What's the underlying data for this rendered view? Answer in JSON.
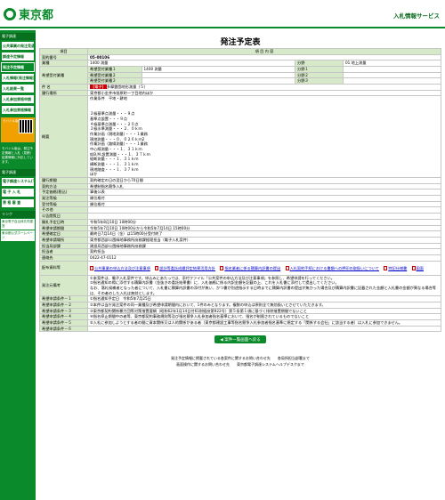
{
  "header": {
    "logo": "東京都",
    "service": "入札情報サービス"
  },
  "sidebar": {
    "sec1": "電子調達",
    "items": [
      "公共事業の発注見通し",
      "調達予定情報",
      "発注予定情報",
      "入札情報(発注情報)",
      "入札結果一覧",
      "入札参加資格申請",
      "入札参加資格情報"
    ],
    "mobile": "モバイル版はこちら",
    "mobile_note": "モバイル版は、発注予定情報と入札（見積）結果情報に対応しています。",
    "sec2": "電子調達",
    "sys_btn": "電子調達システム(TOP)",
    "nav": [
      "電 子 入 札",
      "資 格 審 査"
    ],
    "sec3": "リンク",
    "links": [
      "東京電子自治体共同運営",
      "東京都公式ホームページ"
    ]
  },
  "page": {
    "title": "発注予定表",
    "col_item": "項目",
    "col_content": "項 目 内 容"
  },
  "rows": {
    "contract_no": {
      "label": "契約番号",
      "value": "05-00106"
    },
    "gyoshu": {
      "label": "業種",
      "value": "1400 測量",
      "bunya_label": "分野",
      "bunya_value": "01 地上測量"
    },
    "kibou": [
      {
        "label": "希望受付業種１",
        "value": "1400 測量",
        "bunya_label": "分野１",
        "bunya_value": ""
      },
      {
        "label": "希望受付業種２",
        "value": "",
        "bunya_label": "分野２",
        "bunya_value": ""
      },
      {
        "label": "希望受付業種３",
        "value": "",
        "bunya_label": "分野３",
        "bunya_value": ""
      }
    ],
    "kibou_group_label": "希望受付業種",
    "kenmei": {
      "label": "件 名",
      "badge": "【電子】",
      "value": "多摩霊園地形測量（５）"
    },
    "place": {
      "label": "履行場所",
      "value": "東京都小金井市前原町一丁目地内ほか"
    },
    "gaiyo": {
      "label": "概要",
      "value": "作業条件　平地・耕地\n\n\n３級基準点測量・・・９点\n基準点設置・・・９点\n４級基準点測量・・・２０点\n３級水準測量・・・２．０ｋｍ\n作業計画（現地測量）・・・１業務\n現地測量・・・０．０２６ｋｍ2\n作業計画（路線測量）・・・１業務\n中心線測量・・・１．３１ｋｍ\n仮B.M.設置測量・・・１．３７ｋｍ\n縦断測量・・・１．３１ｋｍ\n横断測量・・・１．３１ｋｍ\n現地踏査・・・１．３７ｋｍ\nほか"
    },
    "kikan": {
      "label": "履行期間",
      "value": "契約確定の日の翌日から70日間"
    },
    "hoho": {
      "label": "契約方法",
      "value": "希望制指名競争入札"
    },
    "yotei": {
      "label": "予定価格(税込)",
      "value": "事後公表"
    },
    "hacchu": {
      "label": "発注等級",
      "value": "順位格付"
    },
    "uketsuke": {
      "label": "受付等級",
      "value": "順位格付"
    },
    "other": {
      "label": "その他",
      "value": ""
    },
    "koukai": {
      "label": "公告閲覧日",
      "value": ""
    },
    "kaisatsu": {
      "label": "開札予定日時",
      "value": "令和5年8月10日 10時00分"
    },
    "shinsei": {
      "label": "希望申請期間",
      "value": "令和5年7月10日 10時00分から令和5年7月14日 15時00分"
    },
    "kessai": {
      "label": "希望確定日",
      "value": "最終日7月14日（金）は15時00分受付終了"
    },
    "shinsei_place": {
      "label": "希望申請場所",
      "value": "東京都西部公園緑地事務所庶務課経理担当（電子入札案件）"
    },
    "tanto": {
      "label": "担当局部課",
      "value": "建設局西部公園緑地事務所庶務課"
    },
    "tantosha": {
      "label": "担当者",
      "value": "契約担当"
    },
    "tel": {
      "label": "連絡先",
      "value": "0422-47-0112"
    },
    "files": {
      "label": "配布資料等",
      "links": [
        "公共事業の申込方法及び注意事項",
        "設計等委託成績評定結果活用方針",
        "指名業者に係る積算内訳書の提出",
        "入札契約手続における書類への押印の取扱いについて",
        "特記仕様書",
        "図面"
      ]
    },
    "notes": {
      "label": "発注元備考",
      "value": "①本案件は、電子入札案件です。申込みにあたっては、添付ファイル「公共案件の申込方法及び注意事項」を参照し、希望申請を行ってください。\n②指名通知の際に添付する積算内訳書（金抜きの委託結果書）に、入札価格に係る内訳金額を記載の上、これを入札書に添付して提出してください。\nなお、落札候補者となった者について、入札書に積算内訳書の添付が無い、かつ書が別途指示する日時までに積算内訳書の提出が無かった場合及び積算内訳書に記載された金額と入札書の金額が異なる場合等は、その者のした入札は無効とします。"
    },
    "jouken": [
      {
        "label": "希望申請条件－１",
        "value": "①指名通知予定日　令和5年7月25日"
      },
      {
        "label": "希望申請条件－２",
        "value": "②本件は当庁発注案件の同一業種及び希望申請期間内において、1件のみとなります。複数の申込は原則全て無効扱いとさせていただきます。"
      },
      {
        "label": "希望申請条件－３",
        "value": "③東京都契約関係暴力団等対策措置要綱（昭和62年1月14日付61財経庶第922号）第５条第１項に基づく排除措置期間でないこと"
      },
      {
        "label": "希望申請条件－４",
        "value": "④指名停止期間中の者等、東京都契約事務規則等及び指名競争入札参加者指名基準において、指名が制限されているものでないこと"
      },
      {
        "label": "希望申請条件－５",
        "value": "⑤入札に参加しようとする者の間に資本関係又は人的関係がある者（東京都建設工事等指名競争入札参加者指名基準に規定する「関係する会社」に該当する者）は入札に参加できません。"
      },
      {
        "label": "希望申請条件－６",
        "value": ""
      }
    ]
  },
  "back_button": "案件一覧画面へ戻る",
  "footer": [
    "発注予定情報に掲載されている各案件に関するお問い合わせ先　　各局所担当部署まで",
    "画面操作に関するお問い合わせ先　　東京都電子調達システムヘルプデスクまで"
  ]
}
